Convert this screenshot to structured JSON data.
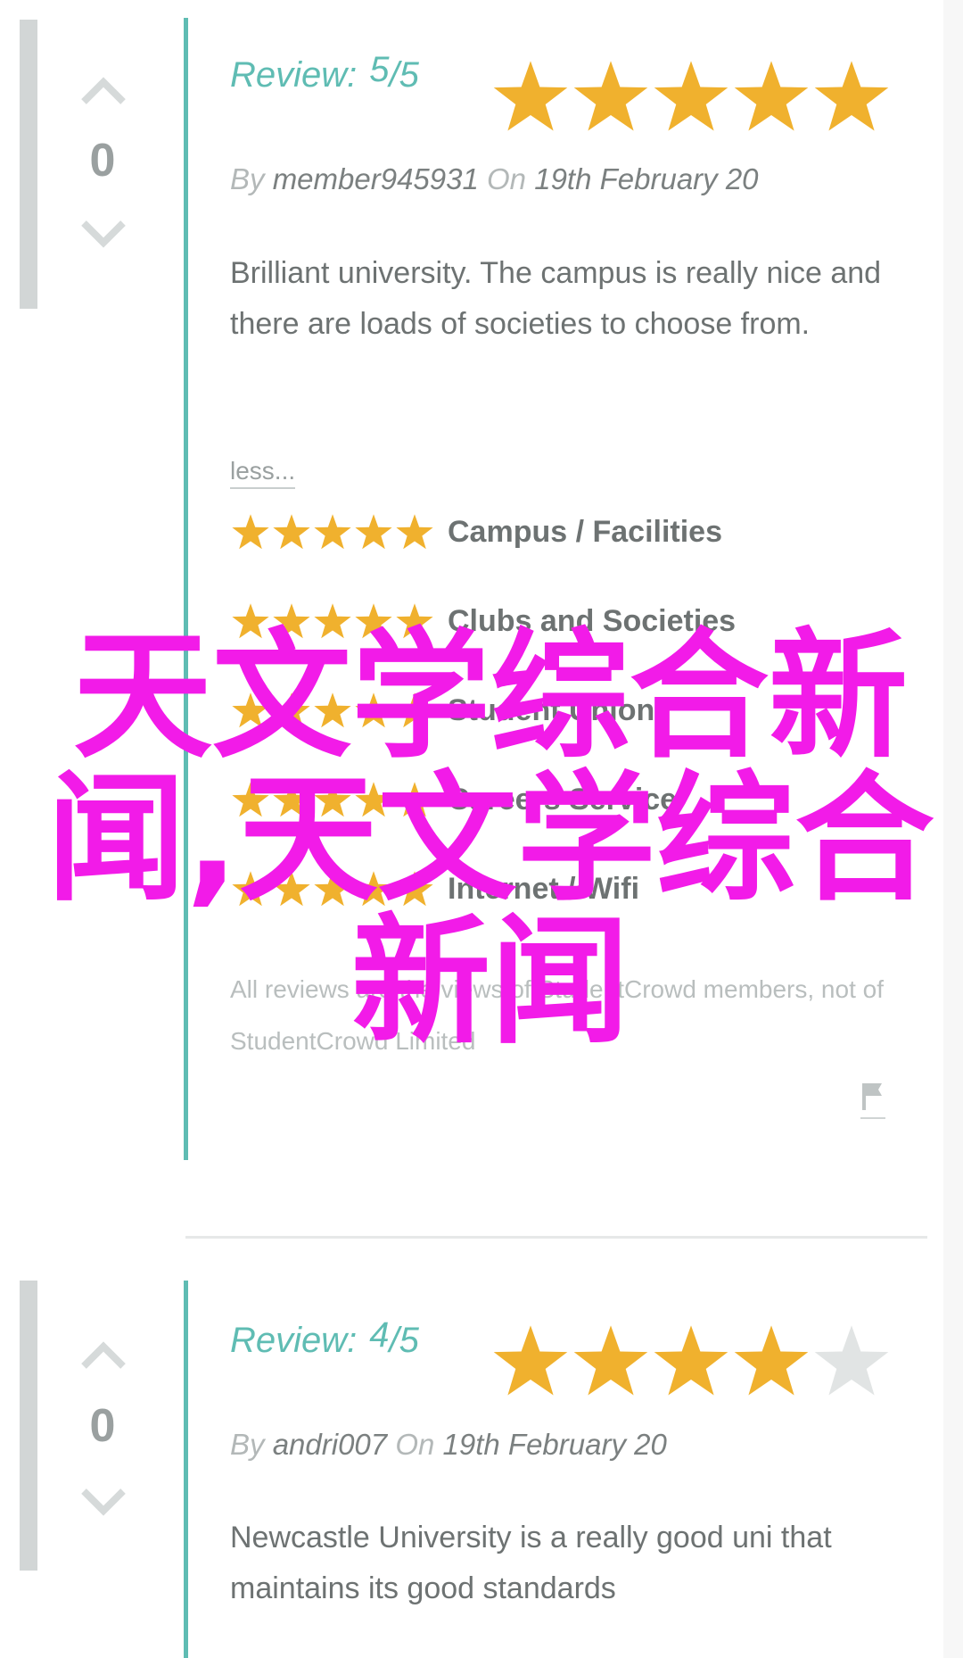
{
  "colors": {
    "accent": "#5fbcb3",
    "star_filled": "#f0b12e",
    "star_empty": "#e1e4e4",
    "watermark": "#f21be8"
  },
  "reviews": [
    {
      "votes": "0",
      "review_label": "Review:",
      "score": "5",
      "score_suffix": "/5",
      "rating": 5,
      "by_label": "By",
      "author": "member945931",
      "on_label": "On",
      "date": "19th February 20",
      "text": "Brilliant university. The campus is really nice and there are loads of societies to choose from.",
      "less_link": "less...",
      "categories": [
        {
          "label": "Campus / Facilities",
          "rating": 5
        },
        {
          "label": "Clubs and Societies",
          "rating": 5
        },
        {
          "label": "Student Union",
          "rating": 5
        },
        {
          "label": "Careers Service",
          "rating": 5
        },
        {
          "label": "Internet / Wifi",
          "rating": 5
        }
      ],
      "disclaimer": "All reviews are the views of StudentCrowd members, not of StudentCrowd Limited"
    },
    {
      "votes": "0",
      "review_label": "Review:",
      "score": "4",
      "score_suffix": "/5",
      "rating": 4,
      "by_label": "By",
      "author": "andri007",
      "on_label": "On",
      "date": "19th February 20",
      "text": "Newcastle University is a really good uni that maintains its good standards"
    }
  ],
  "watermark": "天文学综合新闻,天文学综合新闻"
}
